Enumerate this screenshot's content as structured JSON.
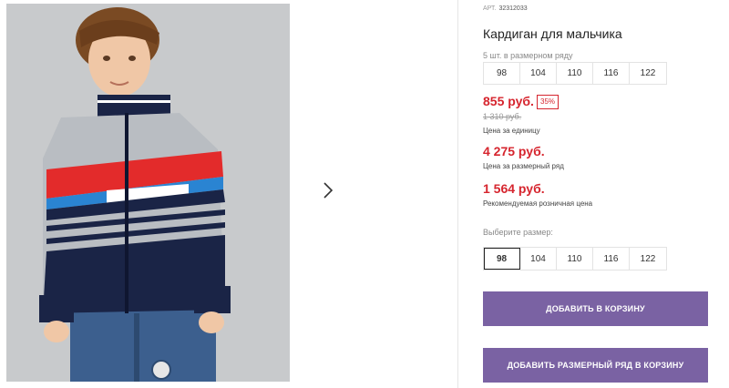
{
  "product": {
    "article_label": "АРТ.",
    "article_number": "32312033",
    "title": "Кардиган для мальчика",
    "pack_note": "5 шт. в размерном ряду",
    "pack_sizes": [
      "98",
      "104",
      "110",
      "116",
      "122"
    ]
  },
  "prices": {
    "unit_price": "855 руб.",
    "discount_badge": "35%",
    "old_price": "1 310 руб.",
    "unit_note": "Цена за единицу",
    "pack_price": "4 275 руб.",
    "pack_note": "Цена за размерный ряд",
    "rrp_price": "1 564 руб.",
    "rrp_note": "Рекомендуемая розничная цена"
  },
  "size_select": {
    "label": "Выберите размер:",
    "options": [
      "98",
      "104",
      "110",
      "116",
      "122"
    ],
    "selected": "98"
  },
  "actions": {
    "add_to_cart": "ДОБАВИТЬ В КОРЗИНУ",
    "add_pack_to_cart": "ДОБАВИТЬ РАЗМЕРНЫЙ РЯД В КОРЗИНУ"
  },
  "gallery": {
    "next_icon": "chevron-right-icon"
  },
  "colors": {
    "price_red": "#d6252e",
    "button_purple": "#7a62a3",
    "border_gray": "#e3e3e3"
  }
}
